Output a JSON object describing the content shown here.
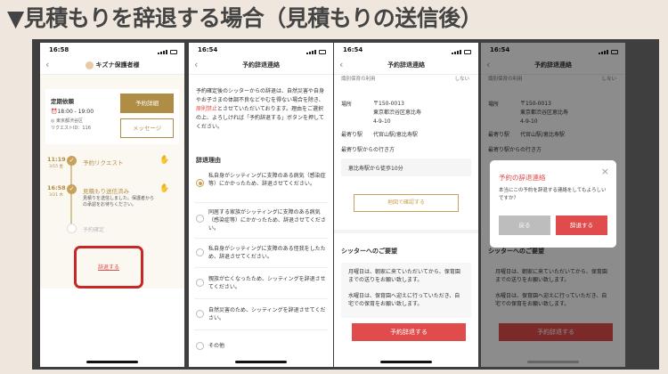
{
  "title": "▼見積もりを辞退する場合（見積もりの送信後）",
  "status_time": [
    "16:58",
    "16:54",
    "16:54",
    "16:54"
  ],
  "s1": {
    "nav_title": "キズナ保護者様",
    "type": "定期依頼",
    "time": "⏰18:00 - 19:00",
    "place": "◎ 東京都渋谷区",
    "req_no": "リクエストID：116",
    "btn_detail": "予約詳細",
    "btn_msg": "メッセージ",
    "tl": [
      {
        "time": "11:19",
        "date": "3/15 金",
        "label": "予約リクエスト"
      },
      {
        "time": "16:58",
        "date": "3/21 木",
        "label": "見積もり送信済み",
        "desc": "見積りを送信しました。保護者からの承認をお待ちください。"
      },
      {
        "label": "予約確定"
      }
    ],
    "decline_link": "辞退する"
  },
  "s2": {
    "nav_title": "予約辞退連絡",
    "intro": "予約確定後のシッターからの辞退は、自然災害や自身やお子さまの体調不良などやむを得ない場合を除き、",
    "intro_red": "原則禁止",
    "intro2": "とさせていただいております。理由をご選択の上、よろしければ「予約辞退する」ボタンを押してください。",
    "section": "辞退理由",
    "reasons": [
      "私自身がシッティングに支障のある病気（感染症等）にかかったため、辞退させてください。",
      "同居する家族がシッティングに支障のある病気（感染症等）にかかったため、辞退させてください。",
      "私自身がシッティングに支障のある怪我をしたため、辞退させてください。",
      "親族が亡くなったため、シッティングを辞退させてください。",
      "自然災害のため、シッティングを辞退させてください。",
      "その他"
    ]
  },
  "s3": {
    "nav_title": "予約辞退連絡",
    "top_row": "識別保育の利用",
    "top_row_val": "しない",
    "loc_label": "場所",
    "loc_val": "〒150-0013\n東京都渋谷区恵比寿\n4-9-10",
    "sta_label": "最寄り駅",
    "sta_val": "代官山駅/恵比寿駅",
    "route_label": "最寄り駅からの行き方",
    "route_val": "恵比寿駅から徒歩10分",
    "map_btn": "地図で確認する",
    "req_title": "シッターへのご要望",
    "req_text": "月曜日は、朝家に来ていただいてから、保育園までの送りをお願い致します。\n\n水曜日は、保育園へ迎えに行っていただき、自宅での保育をお願い致します。",
    "submit": "予約辞退する"
  },
  "s4": {
    "modal_title": "予約の辞退連絡",
    "modal_text": "本当にこの予約を辞退する連絡をしてもよろしいですか？",
    "modal_back": "戻る",
    "modal_ok": "辞退する",
    "close": "×"
  }
}
